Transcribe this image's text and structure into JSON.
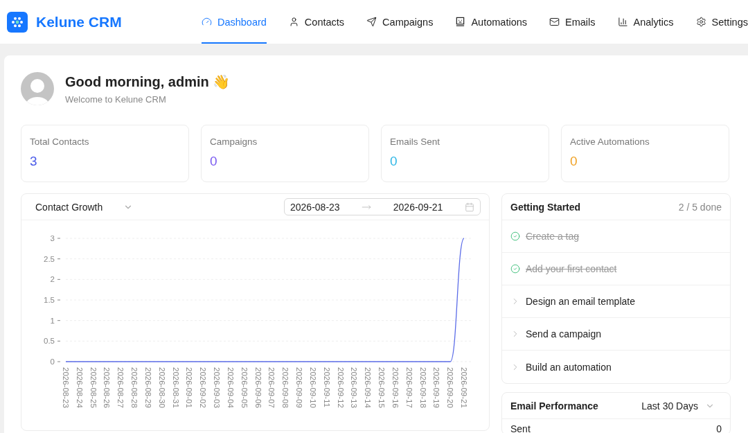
{
  "brand": {
    "name": "Kelune CRM"
  },
  "nav": [
    {
      "label": "Dashboard",
      "selected": true
    },
    {
      "label": "Contacts",
      "selected": false
    },
    {
      "label": "Campaigns",
      "selected": false
    },
    {
      "label": "Automations",
      "selected": false
    },
    {
      "label": "Emails",
      "selected": false
    },
    {
      "label": "Analytics",
      "selected": false
    },
    {
      "label": "Settings",
      "selected": false
    }
  ],
  "greeting": {
    "title": "Good morning, admin",
    "emoji": "👋",
    "subtitle": "Welcome to Kelune CRM"
  },
  "stats": [
    {
      "label": "Total Contacts",
      "value": "3",
      "color": "#4a5be8"
    },
    {
      "label": "Campaigns",
      "value": "0",
      "color": "#7b5cf0"
    },
    {
      "label": "Emails Sent",
      "value": "0",
      "color": "#33b8e6"
    },
    {
      "label": "Active Automations",
      "value": "0",
      "color": "#f0a328"
    }
  ],
  "growth": {
    "metric": "Contact Growth",
    "start_date": "2026-08-23",
    "end_date": "2026-09-21",
    "chart_data": {
      "type": "line",
      "x": [
        "2026-08-23",
        "2026-08-24",
        "2026-08-25",
        "2026-08-26",
        "2026-08-27",
        "2026-08-28",
        "2026-08-29",
        "2026-08-30",
        "2026-08-31",
        "2026-09-01",
        "2026-09-02",
        "2026-09-03",
        "2026-09-04",
        "2026-09-05",
        "2026-09-06",
        "2026-09-07",
        "2026-09-08",
        "2026-09-09",
        "2026-09-10",
        "2026-09-11",
        "2026-09-12",
        "2026-09-13",
        "2026-09-14",
        "2026-09-15",
        "2026-09-16",
        "2026-09-17",
        "2026-09-18",
        "2026-09-19",
        "2026-09-20",
        "2026-09-21"
      ],
      "grid": true,
      "series": [
        {
          "color": "#5b6ce8",
          "values": [
            0,
            0,
            0,
            0,
            0,
            0,
            0,
            0,
            0,
            0,
            0,
            0,
            0,
            0,
            0,
            0,
            0,
            0,
            0,
            0,
            0,
            0,
            0,
            0,
            0,
            0,
            0,
            0,
            0,
            3
          ]
        }
      ],
      "ylim": [
        0,
        3
      ],
      "yticks": [
        0,
        0.5,
        1,
        1.5,
        2,
        2.5,
        3
      ]
    }
  },
  "getting_started": {
    "title": "Getting Started",
    "progress": "2 / 5 done",
    "items": [
      {
        "label": "Create a tag",
        "done": true
      },
      {
        "label": "Add your first contact",
        "done": true
      },
      {
        "label": "Design an email template",
        "done": false
      },
      {
        "label": "Send a campaign",
        "done": false
      },
      {
        "label": "Build an automation",
        "done": false
      }
    ]
  },
  "email_performance": {
    "title": "Email Performance",
    "range": "Last 30 Days",
    "rows": [
      {
        "label": "Sent",
        "value": "0"
      }
    ]
  }
}
